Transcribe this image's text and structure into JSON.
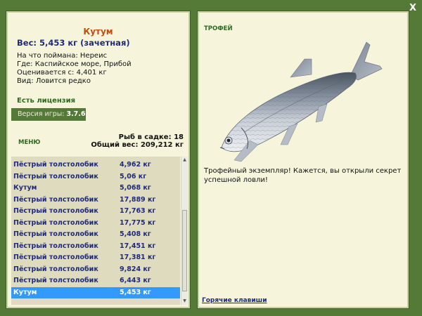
{
  "close": {
    "label": "X"
  },
  "catch_info": {
    "name": "Кутум",
    "weight": "Вес: 5,453 кг (зачетная)",
    "bait": "На что поймана: Нереис",
    "location": "Где: Каспийское море, Прибой",
    "value": "Оценивается с: 4,401 кг",
    "rarity": "Вид: Ловится редко"
  },
  "license": "Есть лицензия",
  "version": {
    "label": "Версия игры:",
    "number": "3.7.6"
  },
  "menu_label": "МЕНЮ",
  "keepnet": {
    "count": "Рыб в садке: 18",
    "total_weight": "Общий вес: 209,212 кг"
  },
  "catch_list": [
    {
      "name": "Пёстрый толстолобик",
      "weight": "4,962 кг",
      "selected": false
    },
    {
      "name": "Пёстрый толстолобик",
      "weight": "5,06 кг",
      "selected": false
    },
    {
      "name": "Кутум",
      "weight": "5,068 кг",
      "selected": false
    },
    {
      "name": "Пёстрый толстолобик",
      "weight": "17,889 кг",
      "selected": false
    },
    {
      "name": "Пёстрый толстолобик",
      "weight": "17,763 кг",
      "selected": false
    },
    {
      "name": "Пёстрый толстолобик",
      "weight": "17,775 кг",
      "selected": false
    },
    {
      "name": "Пёстрый толстолобик",
      "weight": "5,408 кг",
      "selected": false
    },
    {
      "name": "Пёстрый толстолобик",
      "weight": "17,451 кг",
      "selected": false
    },
    {
      "name": "Пёстрый толстолобик",
      "weight": "17,381 кг",
      "selected": false
    },
    {
      "name": "Пёстрый толстолобик",
      "weight": "9,824 кг",
      "selected": false
    },
    {
      "name": "Пёстрый толстолобик",
      "weight": "6,443 кг",
      "selected": false
    },
    {
      "name": "Кутум",
      "weight": "5,453 кг",
      "selected": true
    }
  ],
  "trophy": {
    "label": "ТРОФЕЙ",
    "text": "Трофейный экземпляр! Кажется, вы открыли секрет успешной ловли!"
  },
  "hotkeys_link": "Горячие клавиши",
  "colors": {
    "background": "#557a38",
    "panel": "#f6f5dc",
    "fish_name": "#c14e0f",
    "list_text": "#1e2a7a",
    "selection": "#3399ff",
    "green_label": "#2c6a1c"
  },
  "icons": {
    "close": "close-icon",
    "scroll_up": "arrow-up-icon",
    "scroll_down": "arrow-down-icon"
  }
}
